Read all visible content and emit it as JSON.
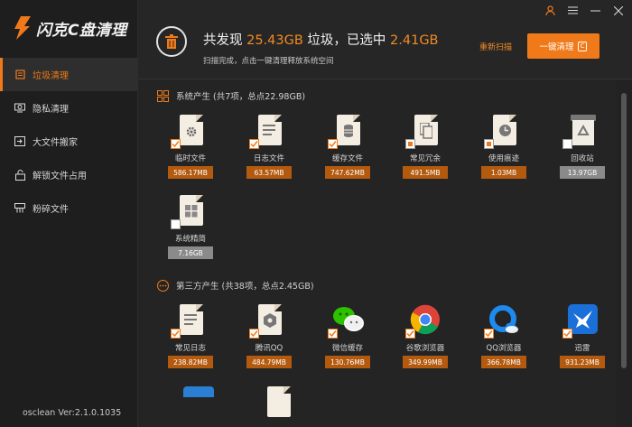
{
  "app": {
    "logo_text": "闪克C盘清理",
    "version": "osclean Ver:2.1.0.1035"
  },
  "sidebar": {
    "items": [
      {
        "label": "垃圾清理",
        "icon": "trash-icon",
        "active": true
      },
      {
        "label": "隐私清理",
        "icon": "privacy-icon",
        "active": false
      },
      {
        "label": "大文件搬家",
        "icon": "move-file-icon",
        "active": false
      },
      {
        "label": "解锁文件占用",
        "icon": "unlock-icon",
        "active": false
      },
      {
        "label": "粉碎文件",
        "icon": "shred-icon",
        "active": false
      }
    ]
  },
  "header": {
    "summary_prefix": "共发现",
    "found_size": "25.43GB",
    "summary_mid": "垃圾，已选中",
    "selected_size": "2.41GB",
    "subline": "扫描完成，点击一键清理释放系统空间",
    "rescan_label": "重新扫描",
    "clean_label": "一键清理",
    "clean_shortcut": "C",
    "accent_color": "#f07a1a"
  },
  "sections": {
    "system": {
      "title": "系统产生 (共7项，总点22.98GB)",
      "items": [
        {
          "name": "临时文件",
          "size": "586.17MB",
          "icon": "gear-doc-icon",
          "check": "checked"
        },
        {
          "name": "日志文件",
          "size": "63.57MB",
          "icon": "log-doc-icon",
          "check": "checked"
        },
        {
          "name": "缓存文件",
          "size": "747.62MB",
          "icon": "cache-doc-icon",
          "check": "checked"
        },
        {
          "name": "常见冗余",
          "size": "491.5MB",
          "icon": "redundant-doc-icon",
          "check": "partial"
        },
        {
          "name": "使用痕迹",
          "size": "1.03MB",
          "icon": "clock-doc-icon",
          "check": "partial"
        },
        {
          "name": "回收站",
          "size": "13.97GB",
          "icon": "recycle-bin-icon",
          "check": "unchecked"
        },
        {
          "name": "系统精简",
          "size": "7.16GB",
          "icon": "windows-doc-icon",
          "check": "unchecked"
        }
      ]
    },
    "third_party": {
      "title": "第三方产生 (共38项，总点2.45GB)",
      "items": [
        {
          "name": "常见日志",
          "size": "238.82MB",
          "icon": "log-doc-icon",
          "check": "checked"
        },
        {
          "name": "腾讯QQ",
          "size": "484.79MB",
          "icon": "qq-doc-icon",
          "check": "checked"
        },
        {
          "name": "微信缓存",
          "size": "130.76MB",
          "icon": "wechat-icon",
          "check": "checked"
        },
        {
          "name": "谷歌浏览器",
          "size": "349.99MB",
          "icon": "chrome-icon",
          "check": "checked"
        },
        {
          "name": "QQ浏览器",
          "size": "366.78MB",
          "icon": "qq-browser-icon",
          "check": "checked"
        },
        {
          "name": "迅雷",
          "size": "931.23MB",
          "icon": "xunlei-icon",
          "check": "checked"
        }
      ]
    }
  }
}
